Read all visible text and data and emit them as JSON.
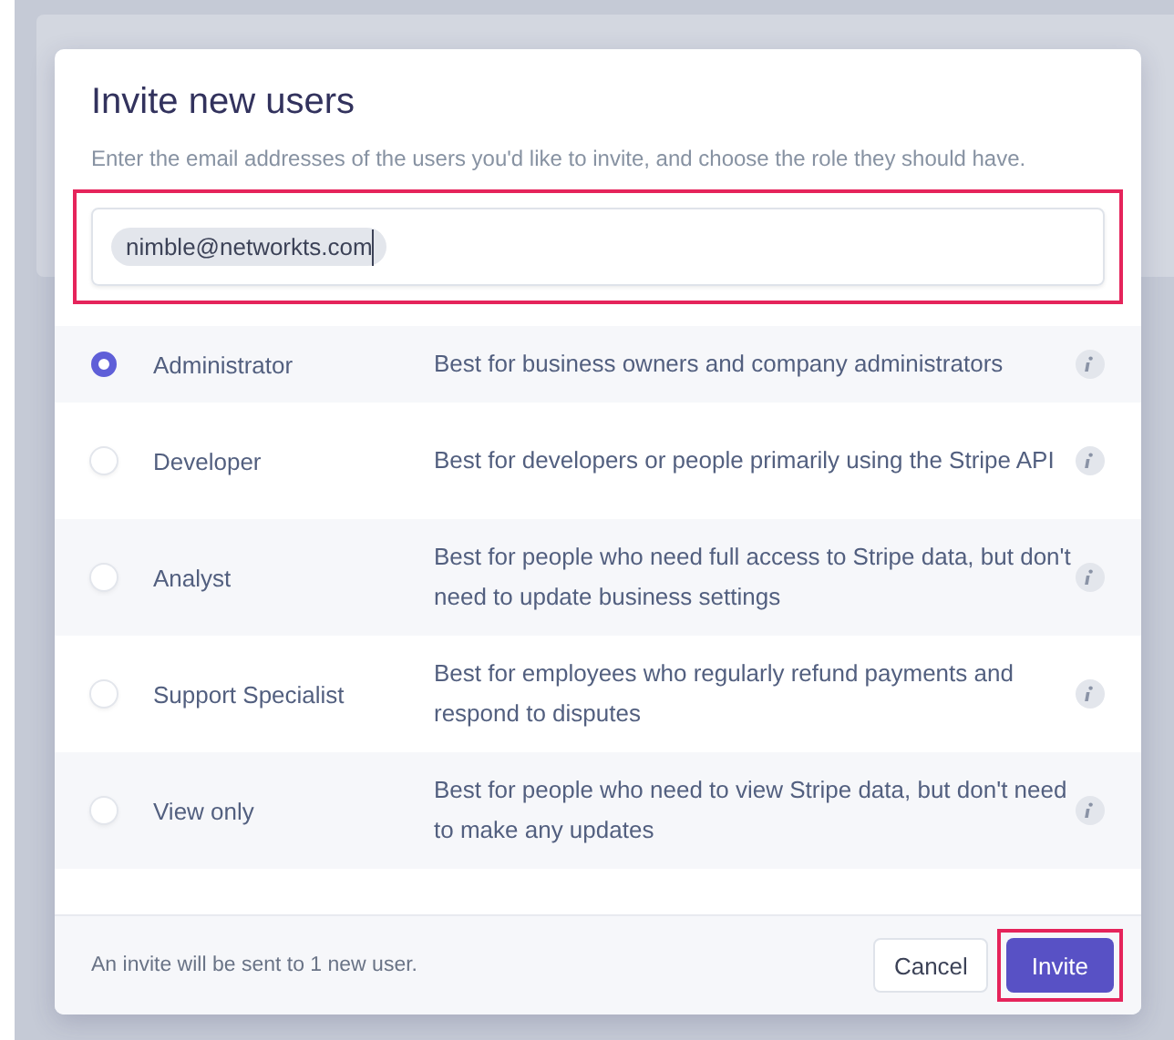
{
  "dialog": {
    "title": "Invite new users",
    "description": "Enter the email addresses of the users you'd like to invite, and choose the role they should have.",
    "email_field": {
      "tokens": [
        "nimble@networkts.com"
      ],
      "highlighted": true
    },
    "roles": [
      {
        "name": "Administrator",
        "description": "Best for business owners and company administrators",
        "selected": true
      },
      {
        "name": "Developer",
        "description": "Best for developers or people primarily using the Stripe API",
        "selected": false
      },
      {
        "name": "Analyst",
        "description": "Best for people who need full access to Stripe data, but don't need to update business settings",
        "selected": false
      },
      {
        "name": "Support Specialist",
        "description": "Best for employees who regularly refund payments and respond to disputes",
        "selected": false
      },
      {
        "name": "View only",
        "description": "Best for people who need to view Stripe data, but don't need to make any updates",
        "selected": false
      }
    ],
    "footer_note": "An invite will be sent to 1 new user.",
    "buttons": [
      {
        "label": "Cancel",
        "kind": "secondary",
        "highlighted": false
      },
      {
        "label": "Invite",
        "kind": "primary",
        "highlighted": true
      }
    ]
  }
}
